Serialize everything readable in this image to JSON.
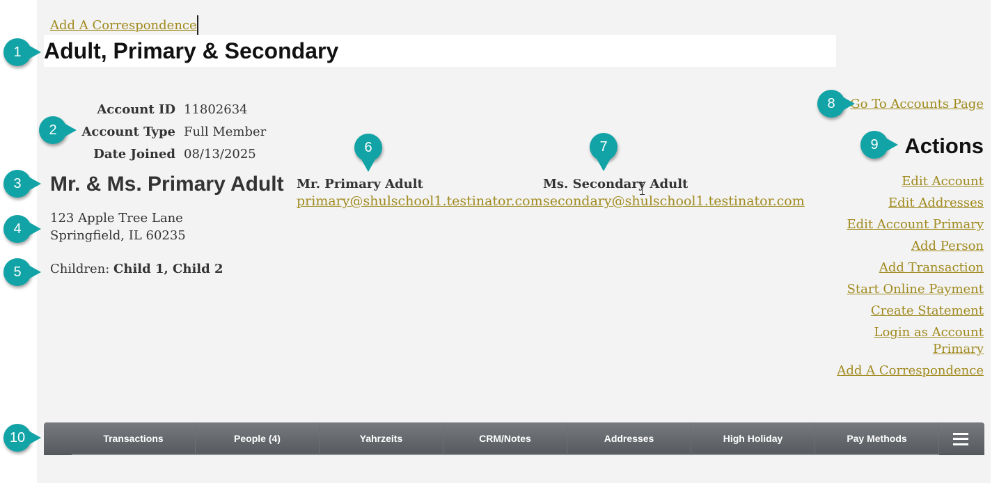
{
  "top_link": "Add A Correspondence",
  "page_title": "Adult, Primary & Secondary",
  "account": {
    "fields": [
      {
        "label": "Account ID",
        "value": "11802634"
      },
      {
        "label": "Account Type",
        "value": "Full Member"
      },
      {
        "label": "Date Joined",
        "value": "08/13/2025"
      }
    ],
    "name": "Mr. & Ms. Primary Adult",
    "address_line1": "123 Apple Tree Lane",
    "address_line2": "Springfield, IL 60235",
    "children_label": "Children: ",
    "children_value": "Child 1, Child 2"
  },
  "primary": {
    "name": "Mr. Primary Adult",
    "email": "primary@shulschool1.testinator.com"
  },
  "secondary": {
    "name": "Ms. Secondary Adult",
    "email": "secondary@shulschool1.testinator.com"
  },
  "goto_accounts": "Go To Accounts Page",
  "actions": {
    "title": "Actions",
    "items": [
      "Edit Account",
      "Edit Addresses",
      "Edit Account Primary",
      "Add Person",
      "Add Transaction",
      "Start Online Payment",
      "Create Statement",
      "Login as Account Primary",
      "Add A Correspondence"
    ]
  },
  "tabs": [
    "Transactions",
    "People (4)",
    "Yahrzeits",
    "CRM/Notes",
    "Addresses",
    "High Holiday",
    "Pay Methods"
  ],
  "callouts": [
    "1",
    "2",
    "3",
    "4",
    "5",
    "6",
    "7",
    "8",
    "9",
    "10"
  ],
  "colors": {
    "link": "#a08a1e",
    "callout": "#12a3a6",
    "panel": "#f3f3f3",
    "tabbar": "#5f6367"
  }
}
